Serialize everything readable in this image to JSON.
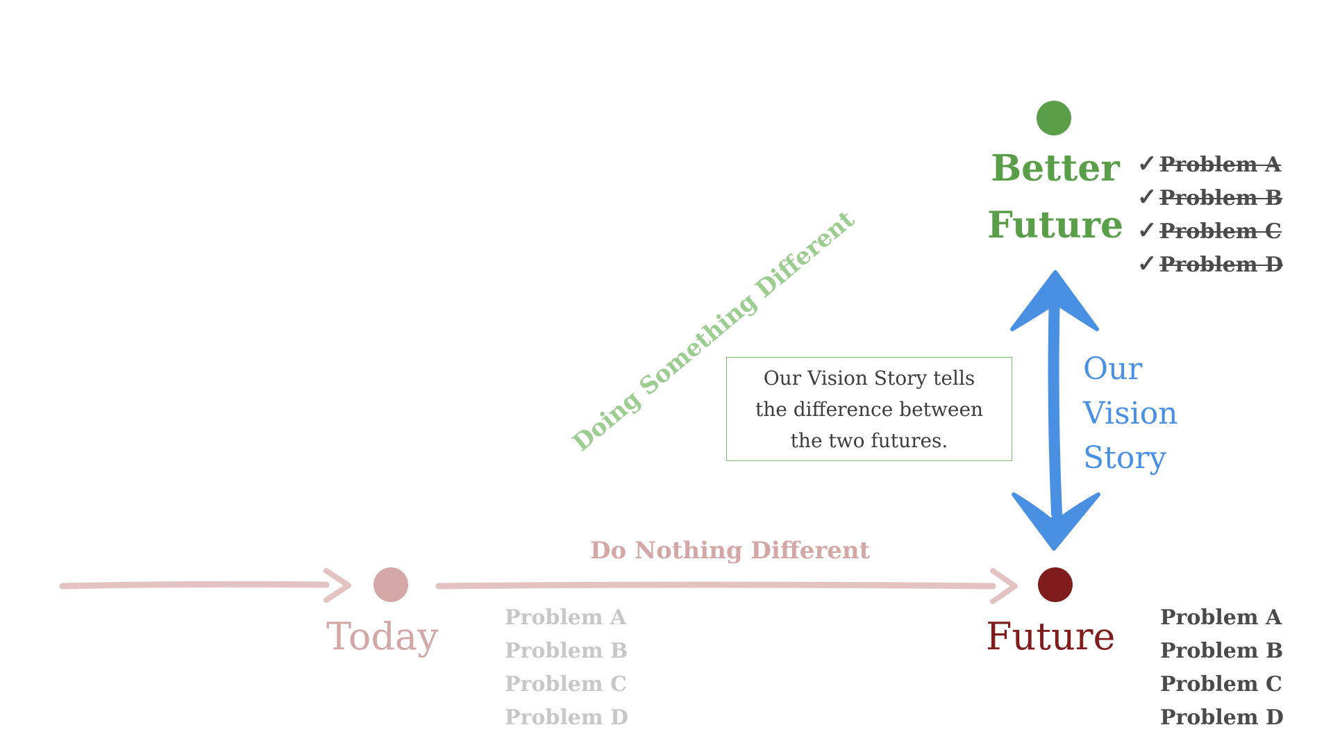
{
  "nodes": {
    "today": {
      "label": "Today",
      "color": "#d4a8a7"
    },
    "future": {
      "label": "Future",
      "color": "#7f1d1d"
    },
    "better_future": {
      "label_line1": "Better",
      "label_line2": "Future",
      "color": "#5a9e4a"
    }
  },
  "today_problems": [
    "Problem A",
    "Problem B",
    "Problem C",
    "Problem D"
  ],
  "future_problems": [
    "Problem A",
    "Problem B",
    "Problem C",
    "Problem D"
  ],
  "better_problems": {
    "check_icon": "✓",
    "items": [
      "Problem A",
      "Problem B",
      "Problem C",
      "Problem D"
    ]
  },
  "paths": {
    "do_nothing": "Do Nothing Different",
    "doing_something": "Doing Something Different"
  },
  "vision_box": {
    "lines": [
      "Our Vision Story tells",
      "the difference between",
      "the two futures."
    ]
  },
  "vision_label": {
    "lines": [
      "Our",
      "Vision",
      "Story"
    ],
    "color": "#4a90e2"
  },
  "arrow_colors": {
    "timeline": "#e2c3c2",
    "vision": "#4a90e2"
  }
}
